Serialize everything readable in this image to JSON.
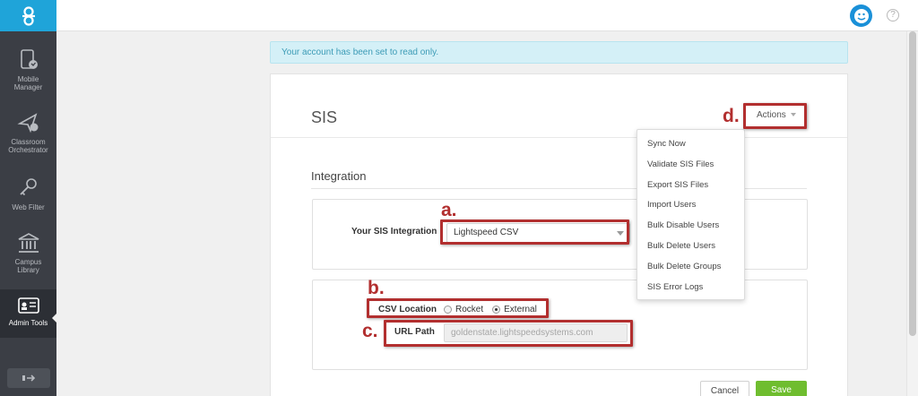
{
  "sidebar": {
    "items": [
      {
        "label_line1": "Mobile",
        "label_line2": "Manager"
      },
      {
        "label_line1": "Classroom",
        "label_line2": "Orchestrator"
      },
      {
        "label_line1": "Web Filter",
        "label_line2": ""
      },
      {
        "label_line1": "Campus",
        "label_line2": "Library"
      },
      {
        "label_line1": "Admin Tools",
        "label_line2": ""
      }
    ]
  },
  "alert": {
    "text": "Your account has been set to read only."
  },
  "page": {
    "title": "SIS"
  },
  "actions": {
    "label": "Actions",
    "menu": [
      "Sync Now",
      "Validate SIS Files",
      "Export SIS Files",
      "Import Users",
      "Bulk Disable Users",
      "Bulk Delete Users",
      "Bulk Delete Groups",
      "SIS Error Logs"
    ]
  },
  "integration": {
    "section_title": "Integration",
    "sis_label": "Your SIS Integration",
    "sis_value": "Lightspeed CSV",
    "csv_location_label": "CSV Location",
    "csv_options": [
      "Rocket",
      "External"
    ],
    "csv_selected": "External",
    "url_label": "URL Path",
    "url_value": "goldenstate.lightspeedsystems.com"
  },
  "buttons": {
    "cancel": "Cancel",
    "save": "Save"
  },
  "annotations": {
    "a": "a.",
    "b": "b.",
    "c": "c.",
    "d": "d."
  },
  "colors": {
    "brand": "#1fa4d9",
    "sidebar": "#3b3e45",
    "annotation": "#b22f2f",
    "save": "#6fbd2f",
    "alert_bg": "#d4f0f7"
  }
}
